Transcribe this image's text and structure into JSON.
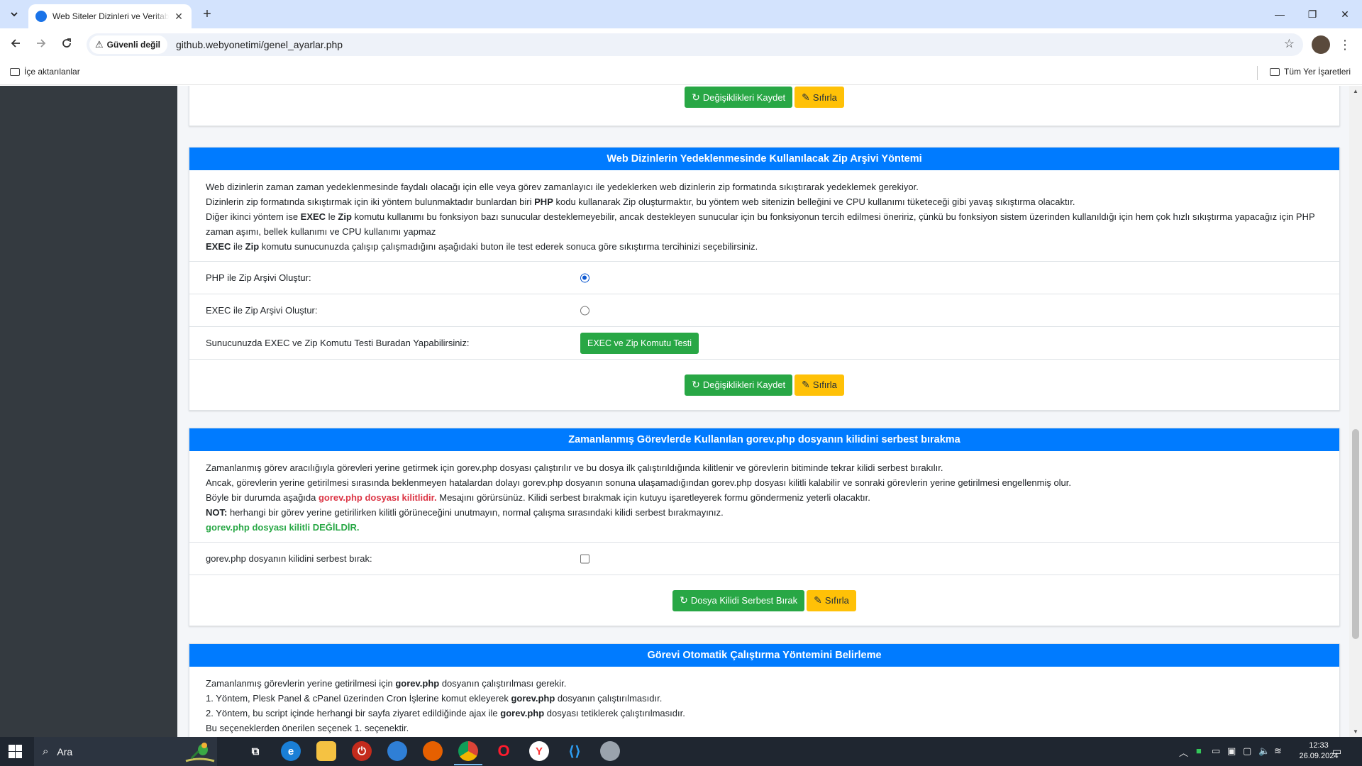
{
  "browser": {
    "tab_title": "Web Siteler Dizinleri ve Veritabanları",
    "security_label": "Güvenli değil",
    "url": "github.webyonetimi/genel_ayarlar.php",
    "bookmarks_left": "İçe aktarılanlar",
    "bookmarks_right": "Tüm Yer İşaretleri"
  },
  "buttons": {
    "save": "Değişiklikleri Kaydet",
    "reset": "Sıfırla",
    "exec_test": "EXEC ve Zip Komutu Testi",
    "unlock": "Dosya Kilidi Serbest Bırak"
  },
  "zip_card": {
    "title": "Web Dizinlerin Yedeklenmesinde Kullanılacak Zip Arşivi Yöntemi",
    "p1": "Web dizinlerin zaman zaman yedeklenmesinde faydalı olacağı için elle veya görev zamanlayıcı ile yedeklerken web dizinlerin zip formatında sıkıştırarak yedeklemek gerekiyor.",
    "p2_a": "Dizinlerin zip formatında sıkıştırmak için iki yöntem bulunmaktadır bunlardan biri ",
    "p2_b": "PHP",
    "p2_c": " kodu kullanarak Zip oluşturmaktır, bu yöntem web sitenizin belleğini ve CPU kullanımı tüketeceği gibi yavaş sıkıştırma olacaktır.",
    "p3_a": "Diğer ikinci yöntem ise ",
    "p3_b": "EXEC",
    "p3_c": " le ",
    "p3_d": "Zip",
    "p3_e": " komutu kullanımı bu fonksiyon bazı sunucular desteklemeyebilir, ancak destekleyen sunucular için bu fonksiyonun tercih edilmesi öneririz, çünkü bu fonksiyon sistem üzerinden kullanıldığı için hem çok hızlı sıkıştırma yapacağız için PHP zaman aşımı, bellek kullanımı ve CPU kullanımı yapmaz",
    "p4_a": "EXEC",
    "p4_b": " ile ",
    "p4_c": "Zip",
    "p4_d": " komutu sunucunuzda çalışıp çalışmadığını aşağıdaki buton ile test ederek sonuca göre sıkıştırma tercihinizi seçebilirsiniz.",
    "opt_php": "PHP ile Zip Arşivi Oluştur:",
    "opt_exec": "EXEC ile Zip Arşivi Oluştur:",
    "test_label": "Sunucunuzda EXEC ve Zip Komutu Testi Buradan Yapabilirsiniz:",
    "selected_method": "PHP"
  },
  "lock_card": {
    "title": "Zamanlanmış Görevlerde Kullanılan gorev.php dosyanın kilidini serbest bırakma",
    "p1": "Zamanlanmış görev aracılığıyla görevleri yerine getirmek için gorev.php dosyası çalıştırılır ve bu dosya ilk çalıştırıldığında kilitlenir ve görevlerin bitiminde tekrar kilidi serbest bırakılır.",
    "p2": "Ancak, görevlerin yerine getirilmesi sırasında beklenmeyen hatalardan dolayı gorev.php dosyanın sonuna ulaşamadığından gorev.php dosyası kilitli kalabilir ve sonraki görevlerin yerine getirilmesi engellenmiş olur.",
    "p3_a": "Böyle bir durumda aşağıda ",
    "p3_b": "gorev.php dosyası kilitlidir.",
    "p3_c": " Mesajını görürsünüz. Kilidi serbest bırakmak için kutuyu işaretleyerek formu göndermeniz yeterli olacaktır.",
    "p4_a": "NOT:",
    "p4_b": " herhangi bir görev yerine getirilirken kilitli görüneceğini unutmayın, normal çalışma sırasındaki kilidi serbest bırakmayınız.",
    "status": "gorev.php dosyası kilitli DEĞİLDİR.",
    "checkbox_label": "gorev.php dosyanın kilidini serbest bırak:",
    "checked": false
  },
  "auto_card": {
    "title": "Görevi Otomatik Çalıştırma Yöntemini Belirleme",
    "p1_a": "Zamanlanmış görevlerin yerine getirilmesi için ",
    "p1_b": "gorev.php",
    "p1_c": " dosyanın çalıştırılması gerekir.",
    "p2_a": " 1. Yöntem, Plesk Panel & cPanel üzerinden Cron İşlerine komut ekleyerek ",
    "p2_b": "gorev.php",
    "p2_c": " dosyanın çalıştırılmasıdır.",
    "p3_a": " 2. Yöntem, bu script içinde herhangi bir sayfa ziyaret edildiğinde ajax ile ",
    "p3_b": "gorev.php",
    "p3_c": " dosyası tetiklerek çalıştırılmasıdır.",
    "p4": "Bu seçeneklerden önerilen seçenek 1. seçenektir."
  },
  "taskbar": {
    "search_placeholder": "Ara",
    "time": "12:33",
    "date": "26.09.2024"
  },
  "colors": {
    "primary": "#007bff",
    "success": "#28a745",
    "warning": "#ffc107",
    "danger": "#dc3545",
    "sidebar": "#343a40"
  }
}
